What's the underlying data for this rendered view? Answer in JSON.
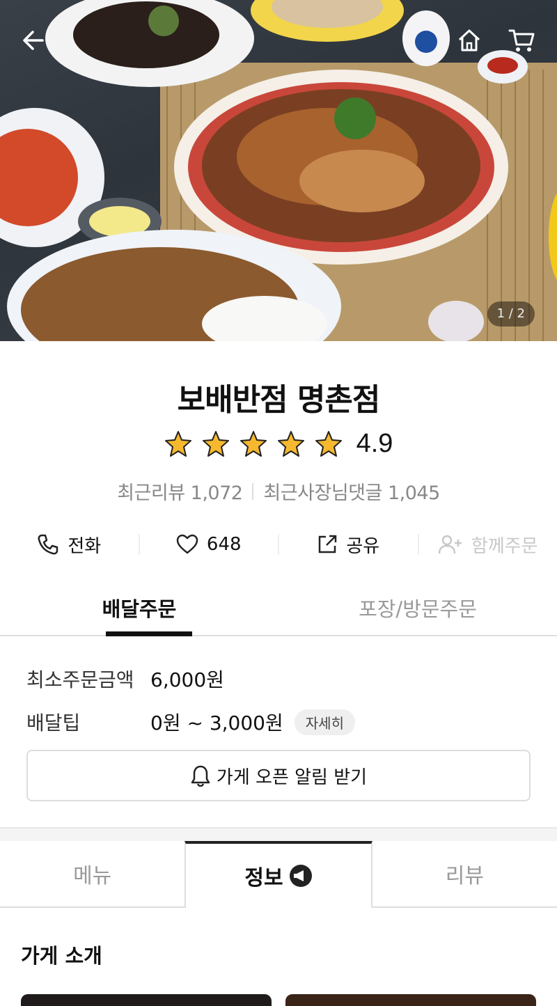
{
  "hero": {
    "pager": "1 / 2",
    "back_icon": "arrow-left-icon",
    "home_icon": "home-icon",
    "cart_icon": "cart-icon"
  },
  "store": {
    "name": "보배반점 명촌점",
    "rating": "4.9",
    "stars": 5,
    "recent_reviews": "최근리뷰 1,072",
    "owner_replies": "최근사장님댓글 1,045"
  },
  "actions": [
    {
      "label": "전화",
      "icon": "phone-icon"
    },
    {
      "label": "648",
      "icon": "heart-icon"
    },
    {
      "label": "공유",
      "icon": "share-icon"
    },
    {
      "label": "함께주문",
      "icon": "add-user-icon"
    }
  ],
  "order_tabs": [
    "배달주문",
    "포장/방문주문"
  ],
  "delivery": {
    "min_order_label": "최소주문금액",
    "min_order_value": "6,000원",
    "tip_label": "배달팁",
    "tip_value": "0원 ~ 3,000원",
    "detail_chip": "자세히",
    "notify_button": "가게 오픈 알림 받기"
  },
  "main_tabs": [
    "메뉴",
    "정보",
    "리뷰"
  ],
  "section_title": "가게 소개",
  "colors": {
    "star": "#f5b82e",
    "active_tab_underline": "#111111"
  }
}
